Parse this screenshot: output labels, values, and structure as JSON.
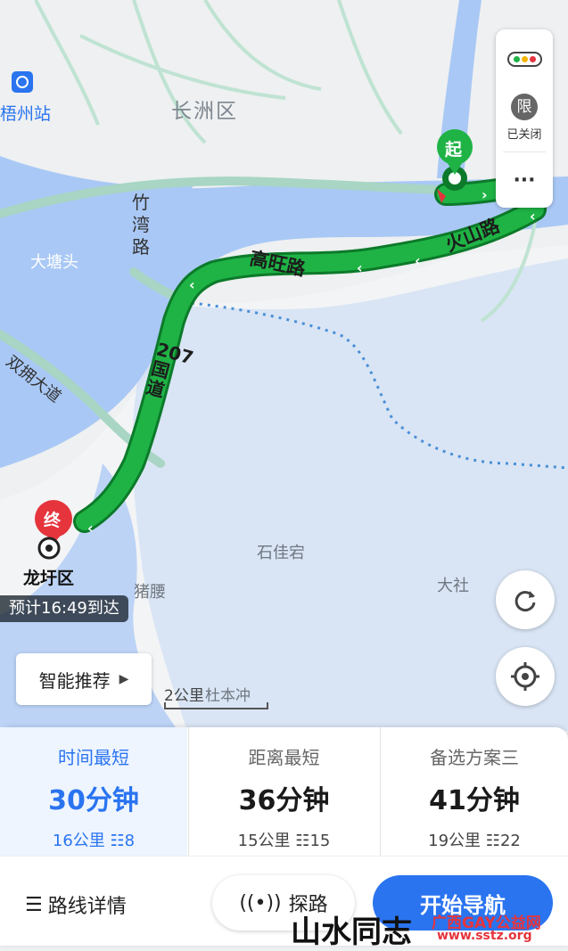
{
  "map": {
    "district": "长洲区",
    "station": "梧州站",
    "place_1": "大塘头",
    "place_2": "石佳宕",
    "place_3": "猪腰",
    "place_4": "大社",
    "place_5": "杜本冲",
    "road_1": "竹湾路",
    "road_2": "双拥大道",
    "road_3": "高旺路",
    "road_4": "火山路",
    "road_5": "207国道",
    "start_marker": "起",
    "end_marker": "终",
    "end_name": "龙圩区",
    "eta": "预计16:49到达",
    "scale": "2公里",
    "restriction_label": "限",
    "restriction_status": "已关闭",
    "more": "···",
    "smart_recommend": "智能推荐"
  },
  "routes": [
    {
      "title": "时间最短",
      "duration": "30分钟",
      "distance": "16公里",
      "lights": "8",
      "selected": true
    },
    {
      "title": "距离最短",
      "duration": "36分钟",
      "distance": "15公里",
      "lights": "15",
      "selected": false
    },
    {
      "title": "备选方案三",
      "duration": "41分钟",
      "distance": "19公里",
      "lights": "22",
      "selected": false
    }
  ],
  "actions": {
    "details": "路线详情",
    "explore": "探路",
    "navigate": "开始导航"
  },
  "watermark": {
    "left": "山水同志",
    "right_top": "广西GAY公益网",
    "right_bottom": "www.sstz.org"
  },
  "colors": {
    "route": "#1fb345",
    "water": "#a9c8f5",
    "accent": "#2a74f0",
    "end_marker": "#e5343c"
  }
}
